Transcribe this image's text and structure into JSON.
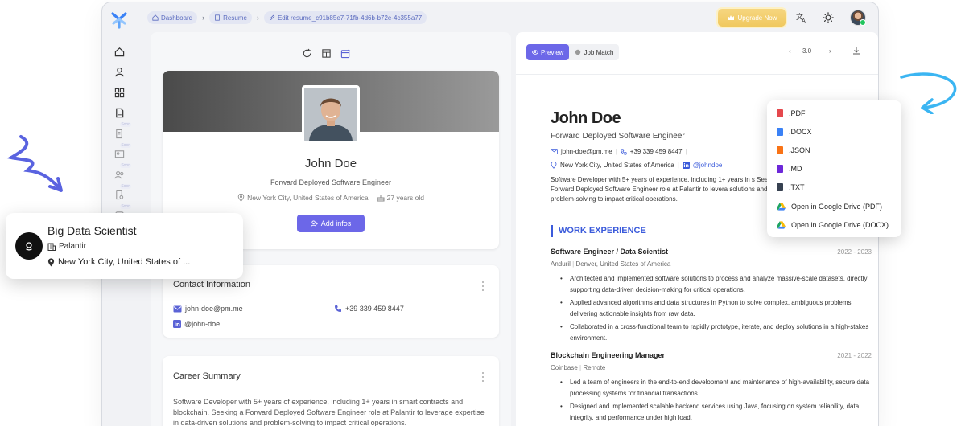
{
  "breadcrumb": {
    "items": [
      "Dashboard",
      "Resume",
      "Edit resume_c91b85e7-71fb-4d6b-b72e-4c355a77"
    ]
  },
  "topbar": {
    "upgrade_label": "Upgrade Now"
  },
  "sidebar": {
    "items": [
      {
        "icon": "home-icon"
      },
      {
        "icon": "user-icon"
      },
      {
        "icon": "dashboard-icon"
      },
      {
        "icon": "document-icon"
      },
      {
        "icon": "edit-doc-icon",
        "badge": "Soon"
      },
      {
        "icon": "id-card-icon",
        "badge": "Soon"
      },
      {
        "icon": "people-icon",
        "badge": "Soon"
      },
      {
        "icon": "search-doc-icon",
        "badge": "Soon"
      },
      {
        "icon": "extra-icon",
        "badge": "Soon"
      }
    ]
  },
  "profile": {
    "name": "John Doe",
    "title": "Forward Deployed Software Engineer",
    "location": "New York City, United States of America",
    "age": "27 years old",
    "add_button": "Add infos"
  },
  "contact": {
    "heading": "Contact Information",
    "email": "john-doe@pm.me",
    "phone": "+39 339 459 8447",
    "linkedin": "@john-doe"
  },
  "career_summary": {
    "heading": "Career Summary",
    "text": "Software Developer with 5+ years of experience, including 1+ years in smart contracts and blockchain. Seeking a Forward Deployed Software Engineer role at Palantir to leverage expertise in data-driven solutions and problem-solving to impact critical operations."
  },
  "preview": {
    "tabs": [
      "Preview",
      "Job Match"
    ],
    "page_indicator": "3.0"
  },
  "resume": {
    "name": "John Doe",
    "title": "Forward Deployed Software Engineer",
    "email": "john-doe@pm.me",
    "phone": "+39 339 459 8447",
    "location": "New York City, United States of America",
    "linkedin": "@johndoe",
    "summary": "Software Developer with 5+ years of experience, including 1+ years in s Seeking a Forward Deployed Software Engineer role at Palantir to levera solutions and problem-solving to impact critical operations.",
    "section_heading": "WORK EXPERIENCE",
    "jobs": [
      {
        "title": "Software Engineer / Data Scientist",
        "dates": "2022 - 2023",
        "company": "Anduril",
        "location": "Denver, United States of America",
        "bullets": [
          "Architected and implemented software solutions to process and analyze massive-scale datasets, directly supporting data-driven decision-making for critical operations.",
          "Applied advanced algorithms and data structures in Python to solve complex, ambiguous problems, delivering actionable insights from raw data.",
          "Collaborated in a cross-functional team to rapidly prototype, iterate, and deploy solutions in a high-stakes environment."
        ]
      },
      {
        "title": "Blockchain Engineering Manager",
        "dates": "2021 - 2022",
        "company": "Coinbase",
        "location": "Remote",
        "bullets": [
          "Led a team of engineers in the end-to-end development and maintenance of high-availability, secure data processing systems for financial transactions.",
          "Designed and implemented scalable backend services using Java, focusing on system reliability, data integrity, and performance under high load."
        ]
      }
    ]
  },
  "export_menu": {
    "items": [
      {
        "label": ".PDF",
        "color": "#e5484d"
      },
      {
        "label": ".DOCX",
        "color": "#3b82f6"
      },
      {
        "label": ".JSON",
        "color": "#f97316"
      },
      {
        "label": ".MD",
        "color": "#6d28d9"
      },
      {
        "label": ".TXT",
        "color": "#374151"
      },
      {
        "label": "Open in Google Drive (PDF)",
        "color": "#1fa463"
      },
      {
        "label": "Open in Google Drive (DOCX)",
        "color": "#1fa463"
      }
    ]
  },
  "job_card": {
    "title": "Big Data Scientist",
    "company": "Palantir",
    "location": "New York City, United States of ..."
  },
  "colors": {
    "accent": "#6c67e8",
    "heading_blue": "#3b5bdb",
    "upgrade": "#f0c85e"
  }
}
